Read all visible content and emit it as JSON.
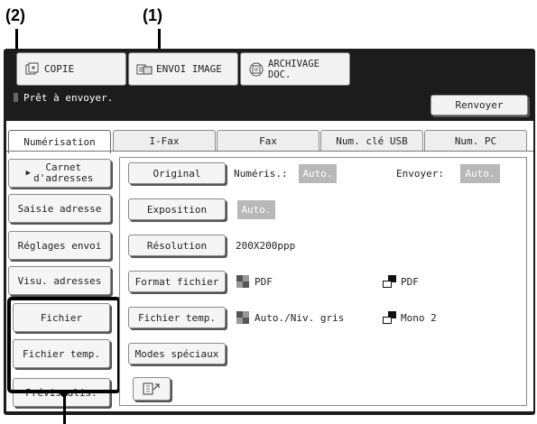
{
  "callouts": {
    "one": "(1)",
    "two": "(2)"
  },
  "mode_tabs": {
    "copie": "COPIE",
    "envoi_image": "ENVOI IMAGE",
    "archivage_line1": "ARCHIVAGE",
    "archivage_line2": "DOC."
  },
  "status": {
    "message": "Prêt à envoyer.",
    "resend_label": "Renvoyer"
  },
  "tabs": [
    "Numérisation",
    "I-Fax",
    "Fax",
    "Num. clé USB",
    "Num. PC"
  ],
  "active_tab": "Numérisation",
  "left_buttons": {
    "carnet_line1": "Carnet",
    "carnet_line2": "d'adresses",
    "saisie": "Saisie adresse",
    "reglages": "Réglages envoi",
    "visu": "Visu. adresses",
    "fichier": "Fichier",
    "fichier_temp": "Fichier temp.",
    "previsualis": "Prévisualis."
  },
  "settings": {
    "original_label": "Original",
    "numeris_label": "Numéris.:",
    "numeris_value": "Auto.",
    "envoyer_label": "Envoyer:",
    "envoyer_value": "Auto.",
    "exposition_label": "Exposition",
    "exposition_value": "Auto.",
    "resolution_label": "Résolution",
    "resolution_value": "200X200ppp",
    "format_label": "Format fichier",
    "format_color_value": "PDF",
    "format_mono_value": "PDF",
    "fichier_temp_label": "Fichier temp.",
    "temp_color_value": "Auto./Niv. gris",
    "temp_mono_value": "Mono 2",
    "modes_label": "Modes spéciaux"
  },
  "icons": {
    "copy": "copy-icon",
    "image_send": "image-send-icon",
    "archive": "document-filing-icon",
    "info": "info-icon",
    "color_swatch": "color-mode-icon",
    "mono_swatch": "mono-mode-icon",
    "toggle": "toggle-icon"
  }
}
